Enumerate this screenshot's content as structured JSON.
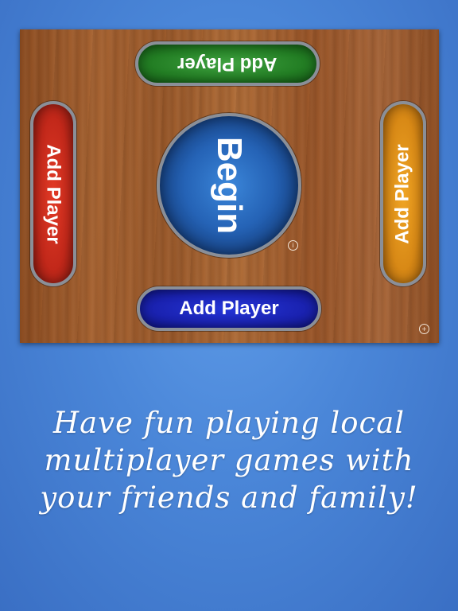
{
  "board": {
    "top_player_label": "Add Player",
    "bottom_player_label": "Add Player",
    "left_player_label": "Add Player",
    "right_player_label": "Add Player",
    "begin_label": "Begin",
    "info_icon": "i",
    "add_icon": "+"
  },
  "colors": {
    "top_player": "#237e24",
    "bottom_player": "#1a22b0",
    "left_player": "#c2281a",
    "right_player": "#d88916",
    "begin_button": "#2563b6",
    "background": "#4a86d8"
  },
  "tagline": {
    "line1": "Have fun playing local",
    "line2": "multiplayer games with",
    "line3": "your friends and family!"
  }
}
